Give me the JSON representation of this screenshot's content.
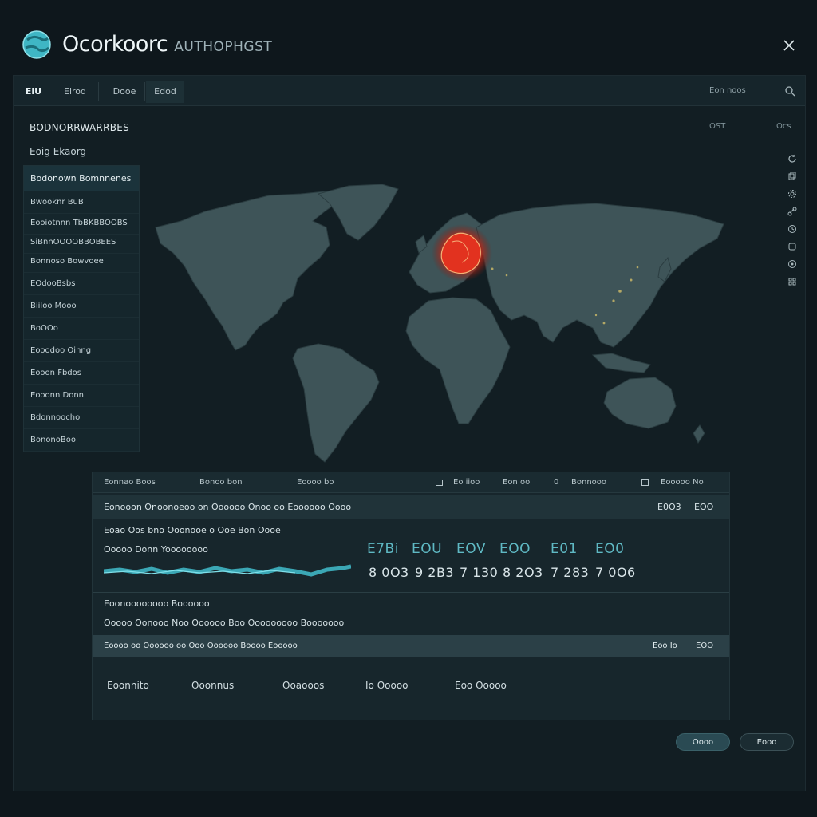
{
  "app": {
    "title": "Ocorkoorc",
    "subtitle": "AUTHOPHGST"
  },
  "tabs": [
    "EiU",
    "Elrod",
    "Dooe",
    "Edod"
  ],
  "search": {
    "label": "Eon noos"
  },
  "sidebar": {
    "heading": "BODNORRWARRBES",
    "subheading": "Eoig Ekaorg",
    "items": [
      "Bodonown Bomnnenes",
      "Bwooknr BuB",
      "Eooiotnnn TbBKBBOOBS",
      "SiBnnOOOOBBOBEES",
      "Bonnoso Bowvoee",
      "EOdooBsbs",
      "Biiloo Mooo",
      "BoOOo",
      "Eooodoo Oinng",
      "Eooon Fbdos",
      "Eooonn Donn",
      "Bdonnoocho",
      "BononoBoo"
    ]
  },
  "top_right": {
    "a": "OST",
    "b": "Ocs"
  },
  "rail_icons": [
    "refresh-icon",
    "copy-icon",
    "settings-icon",
    "link-icon",
    "history-icon",
    "layers-icon",
    "info-icon",
    "grid-icon"
  ],
  "map": {
    "hotspot_region": "Europe",
    "land_color": "#3e5458",
    "hotspot_color": "#e2321f"
  },
  "panel": {
    "header_cols": [
      "Eonnao Boos",
      "Bonoo bon",
      "Eoooo bo"
    ],
    "header_right": [
      "Eo iioo",
      "Eon oo",
      "0",
      "Bonnooo",
      "Eooooo No"
    ],
    "row1": {
      "label": "Eonooon Onoonoeoo on Oooooo Onoo oo Eoooooo Oooo",
      "v1": "E0O3",
      "v2": "EOO"
    },
    "line_a": "Eoao Oos bno Ooonooe o Ooe Bon Oooe",
    "line_b": "Ooooo Donn Yoooooooo",
    "metrics_top": [
      "E7Bi",
      "EOU",
      "EOV",
      "EOO",
      "E01",
      "EO0"
    ],
    "metrics_bot": [
      "8 0O3",
      "9 2B3",
      "7 130",
      "8 2O3",
      "7 283",
      "7 0O6"
    ],
    "line_c": "Eoonoooooooo Boooooo",
    "line_d": "Ooooo Oonooo Noo Oooooo Boo Ooooooooo Booooooo",
    "row2": {
      "label": "Eoooo oo Oooooo oo Ooo Oooooo Boooo Eooooo",
      "v1": "Eoo Io",
      "v2": "EOO"
    },
    "bottom_tabs": [
      "Eoonnito",
      "Ooonnus",
      "Ooaooos",
      "Io Ooooo",
      "Eoo Ooooo"
    ]
  },
  "buttons": {
    "primary": "Oooo",
    "secondary": "Eooo"
  },
  "colors": {
    "accent": "#3fb6c4",
    "background": "#0e171c"
  }
}
